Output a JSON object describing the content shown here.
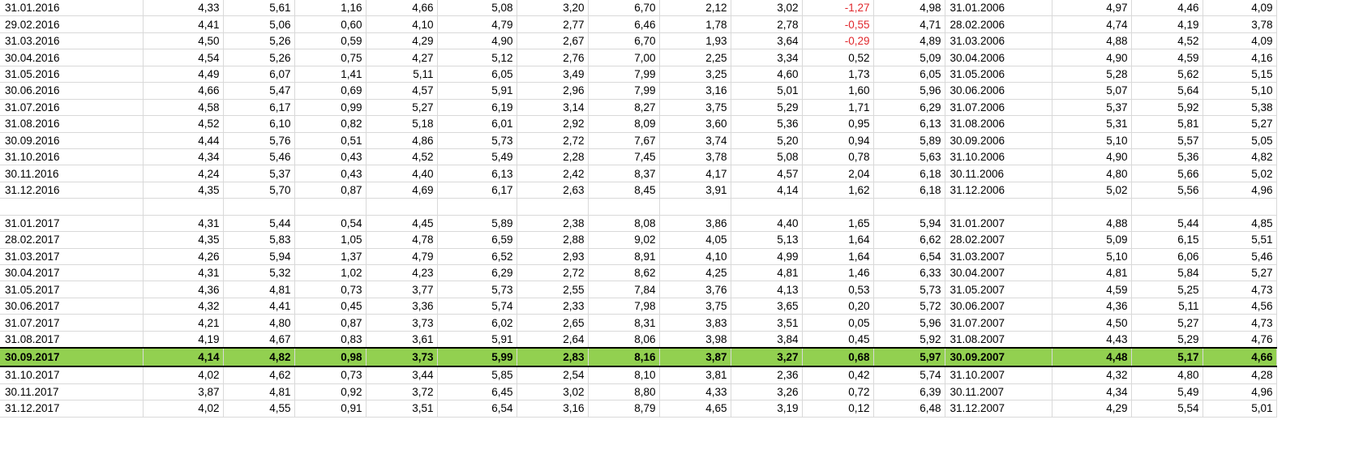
{
  "sheet": {
    "rows": [
      [
        "31.01.2016",
        "4,33",
        "5,61",
        "1,16",
        "4,66",
        "5,08",
        "3,20",
        "6,70",
        "2,12",
        "3,02",
        "-1,27",
        "4,98",
        "31.01.2006",
        "4,97",
        "4,46",
        "4,09"
      ],
      [
        "29.02.2016",
        "4,41",
        "5,06",
        "0,60",
        "4,10",
        "4,79",
        "2,77",
        "6,46",
        "1,78",
        "2,78",
        "-0,55",
        "4,71",
        "28.02.2006",
        "4,74",
        "4,19",
        "3,78"
      ],
      [
        "31.03.2016",
        "4,50",
        "5,26",
        "0,59",
        "4,29",
        "4,90",
        "2,67",
        "6,70",
        "1,93",
        "3,64",
        "-0,29",
        "4,89",
        "31.03.2006",
        "4,88",
        "4,52",
        "4,09"
      ],
      [
        "30.04.2016",
        "4,54",
        "5,26",
        "0,75",
        "4,27",
        "5,12",
        "2,76",
        "7,00",
        "2,25",
        "3,34",
        "0,52",
        "5,09",
        "30.04.2006",
        "4,90",
        "4,59",
        "4,16"
      ],
      [
        "31.05.2016",
        "4,49",
        "6,07",
        "1,41",
        "5,11",
        "6,05",
        "3,49",
        "7,99",
        "3,25",
        "4,60",
        "1,73",
        "6,05",
        "31.05.2006",
        "5,28",
        "5,62",
        "5,15"
      ],
      [
        "30.06.2016",
        "4,66",
        "5,47",
        "0,69",
        "4,57",
        "5,91",
        "2,96",
        "7,99",
        "3,16",
        "5,01",
        "1,60",
        "5,96",
        "30.06.2006",
        "5,07",
        "5,64",
        "5,10"
      ],
      [
        "31.07.2016",
        "4,58",
        "6,17",
        "0,99",
        "5,27",
        "6,19",
        "3,14",
        "8,27",
        "3,75",
        "5,29",
        "1,71",
        "6,29",
        "31.07.2006",
        "5,37",
        "5,92",
        "5,38"
      ],
      [
        "31.08.2016",
        "4,52",
        "6,10",
        "0,82",
        "5,18",
        "6,01",
        "2,92",
        "8,09",
        "3,60",
        "5,36",
        "0,95",
        "6,13",
        "31.08.2006",
        "5,31",
        "5,81",
        "5,27"
      ],
      [
        "30.09.2016",
        "4,44",
        "5,76",
        "0,51",
        "4,86",
        "5,73",
        "2,72",
        "7,67",
        "3,74",
        "5,20",
        "0,94",
        "5,89",
        "30.09.2006",
        "5,10",
        "5,57",
        "5,05"
      ],
      [
        "31.10.2016",
        "4,34",
        "5,46",
        "0,43",
        "4,52",
        "5,49",
        "2,28",
        "7,45",
        "3,78",
        "5,08",
        "0,78",
        "5,63",
        "31.10.2006",
        "4,90",
        "5,36",
        "4,82"
      ],
      [
        "30.11.2016",
        "4,24",
        "5,37",
        "0,43",
        "4,40",
        "6,13",
        "2,42",
        "8,37",
        "4,17",
        "4,57",
        "2,04",
        "6,18",
        "30.11.2006",
        "4,80",
        "5,66",
        "5,02"
      ],
      [
        "31.12.2016",
        "4,35",
        "5,70",
        "0,87",
        "4,69",
        "6,17",
        "2,63",
        "8,45",
        "3,91",
        "4,14",
        "1,62",
        "6,18",
        "31.12.2006",
        "5,02",
        "5,56",
        "4,96"
      ],
      [],
      [
        "31.01.2017",
        "4,31",
        "5,44",
        "0,54",
        "4,45",
        "5,89",
        "2,38",
        "8,08",
        "3,86",
        "4,40",
        "1,65",
        "5,94",
        "31.01.2007",
        "4,88",
        "5,44",
        "4,85"
      ],
      [
        "28.02.2017",
        "4,35",
        "5,83",
        "1,05",
        "4,78",
        "6,59",
        "2,88",
        "9,02",
        "4,05",
        "5,13",
        "1,64",
        "6,62",
        "28.02.2007",
        "5,09",
        "6,15",
        "5,51"
      ],
      [
        "31.03.2017",
        "4,26",
        "5,94",
        "1,37",
        "4,79",
        "6,52",
        "2,93",
        "8,91",
        "4,10",
        "4,99",
        "1,64",
        "6,54",
        "31.03.2007",
        "5,10",
        "6,06",
        "5,46"
      ],
      [
        "30.04.2017",
        "4,31",
        "5,32",
        "1,02",
        "4,23",
        "6,29",
        "2,72",
        "8,62",
        "4,25",
        "4,81",
        "1,46",
        "6,33",
        "30.04.2007",
        "4,81",
        "5,84",
        "5,27"
      ],
      [
        "31.05.2017",
        "4,36",
        "4,81",
        "0,73",
        "3,77",
        "5,73",
        "2,55",
        "7,84",
        "3,76",
        "4,13",
        "0,53",
        "5,73",
        "31.05.2007",
        "4,59",
        "5,25",
        "4,73"
      ],
      [
        "30.06.2017",
        "4,32",
        "4,41",
        "0,45",
        "3,36",
        "5,74",
        "2,33",
        "7,98",
        "3,75",
        "3,65",
        "0,20",
        "5,72",
        "30.06.2007",
        "4,36",
        "5,11",
        "4,56"
      ],
      [
        "31.07.2017",
        "4,21",
        "4,80",
        "0,87",
        "3,73",
        "6,02",
        "2,65",
        "8,31",
        "3,83",
        "3,51",
        "0,05",
        "5,96",
        "31.07.2007",
        "4,50",
        "5,27",
        "4,73"
      ],
      [
        "31.08.2017",
        "4,19",
        "4,67",
        "0,83",
        "3,61",
        "5,91",
        "2,64",
        "8,06",
        "3,98",
        "3,84",
        "0,45",
        "5,92",
        "31.08.2007",
        "4,43",
        "5,29",
        "4,76"
      ],
      [
        "30.09.2017",
        "4,14",
        "4,82",
        "0,98",
        "3,73",
        "5,99",
        "2,83",
        "8,16",
        "3,87",
        "3,27",
        "0,68",
        "5,97",
        "30.09.2007",
        "4,48",
        "5,17",
        "4,66"
      ],
      [
        "31.10.2017",
        "4,02",
        "4,62",
        "0,73",
        "3,44",
        "5,85",
        "2,54",
        "8,10",
        "3,81",
        "2,36",
        "0,42",
        "5,74",
        "31.10.2007",
        "4,32",
        "4,80",
        "4,28"
      ],
      [
        "30.11.2017",
        "3,87",
        "4,81",
        "0,92",
        "3,72",
        "6,45",
        "3,02",
        "8,80",
        "4,33",
        "3,26",
        "0,72",
        "6,39",
        "30.11.2007",
        "4,34",
        "5,49",
        "4,96"
      ],
      [
        "31.12.2017",
        "4,02",
        "4,55",
        "0,91",
        "3,51",
        "6,54",
        "3,16",
        "8,79",
        "4,65",
        "3,19",
        "0,12",
        "6,48",
        "31.12.2007",
        "4,29",
        "5,54",
        "5,01"
      ]
    ],
    "highlight_row_index": 21,
    "colors": {
      "highlight": "#92d050",
      "negative": "#e0282d",
      "gridline": "#d9d9d9"
    }
  }
}
